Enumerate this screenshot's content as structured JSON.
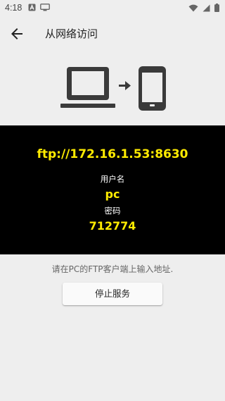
{
  "status_bar": {
    "time": "4:18",
    "left_icons": [
      "a-notification-icon",
      "screen-cast-icon"
    ],
    "right_icons": [
      "wifi-icon",
      "signal-icon",
      "battery-icon"
    ]
  },
  "app_bar": {
    "title": "从网络访问",
    "back_icon": "arrow-left-icon"
  },
  "illustration": {
    "icons": [
      "laptop-icon",
      "arrow-right-icon",
      "phone-icon"
    ]
  },
  "connection": {
    "address": "ftp://172.16.1.53:8630",
    "username_label": "用户名",
    "username": "pc",
    "password_label": "密码",
    "password": "712774"
  },
  "hint": "请在PC的FTP客户端上输入地址.",
  "stop_button_label": "停止服务",
  "colors": {
    "background": "#eeeeee",
    "panel": "#000000",
    "highlight": "#ffeb00",
    "icon": "#3a3a3a"
  }
}
